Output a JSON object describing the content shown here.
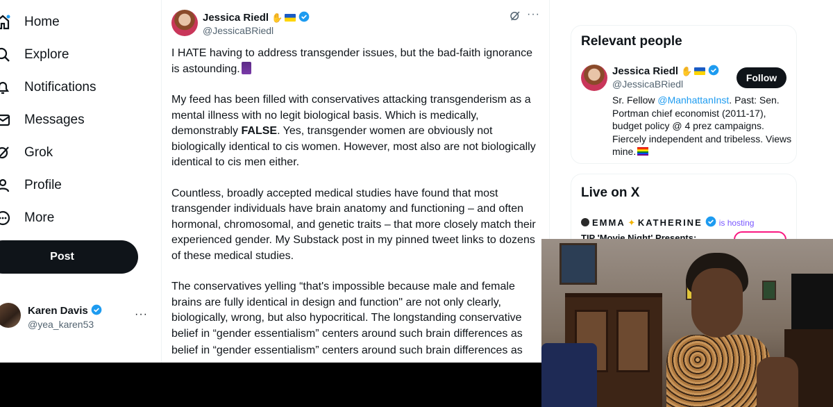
{
  "nav": {
    "items": [
      {
        "label": "Home",
        "icon": "home-icon"
      },
      {
        "label": "Explore",
        "icon": "search-icon"
      },
      {
        "label": "Notifications",
        "icon": "bell-icon"
      },
      {
        "label": "Messages",
        "icon": "envelope-icon"
      },
      {
        "label": "Grok",
        "icon": "grok-icon"
      },
      {
        "label": "Profile",
        "icon": "person-icon"
      },
      {
        "label": "More",
        "icon": "more-circle-icon"
      }
    ],
    "post_label": "Post",
    "account": {
      "name": "Karen Davis",
      "handle": "@yea_karen53",
      "more": "···"
    }
  },
  "tweet": {
    "author_name": "Jessica Riedl",
    "author_handle": "@JessicaBRiedl",
    "more": "···",
    "p1_a": "I HATE having to address transgender issues, but the bad-faith ignorance is astounding.",
    "p2_a": "My feed has been filled with conservatives attacking transgenderism as a mental illness with no legit biological basis. Which is medically, demonstrably ",
    "p2_bold": "FALSE",
    "p2_b": ". Yes, transgender women are obviously not biologically identical to cis women. However, most also are not biologically identical to cis men either.",
    "p3": "Countless, broadly accepted medical studies have found that most transgender individuals have brain anatomy and functioning – and often hormonal, chromosomal, and genetic traits – that more closely match their experienced gender. My Substack post in my pinned tweet links to dozens of these medical studies.",
    "p4": "The conservatives yelling “that's impossible because male and female brains are fully identical in design and function\" are not only clearly, biologically, wrong, but also hypocritical. The longstanding conservative belief in “gender essentialism” centers around such brain differences as",
    "p4_repeat": "belief in “gender essentialism” centers around such brain differences as"
  },
  "relevant": {
    "title": "Relevant people",
    "name": "Jessica Riedl",
    "handle": "@JessicaBRiedl",
    "follow_label": "Follow",
    "bio_a": "Sr. Fellow ",
    "bio_mention": "@ManhattanInst",
    "bio_b": ". Past: Sen. Portman chief economist (2011-17), budget policy @ 4 prez campaigns. Fiercely independent and tribeless. Views mine."
  },
  "live": {
    "title": "Live on X",
    "host_a": "EMMA",
    "host_b": "KATHERINE",
    "hosting": "is hosting",
    "space_title": "TIP 'Movie Night' Presents:"
  },
  "colors": {
    "accent": "#1d9bf0",
    "text": "#0f1419",
    "muted": "#536471",
    "live_pink": "#f91880",
    "hosting_purple": "#7856ff"
  }
}
